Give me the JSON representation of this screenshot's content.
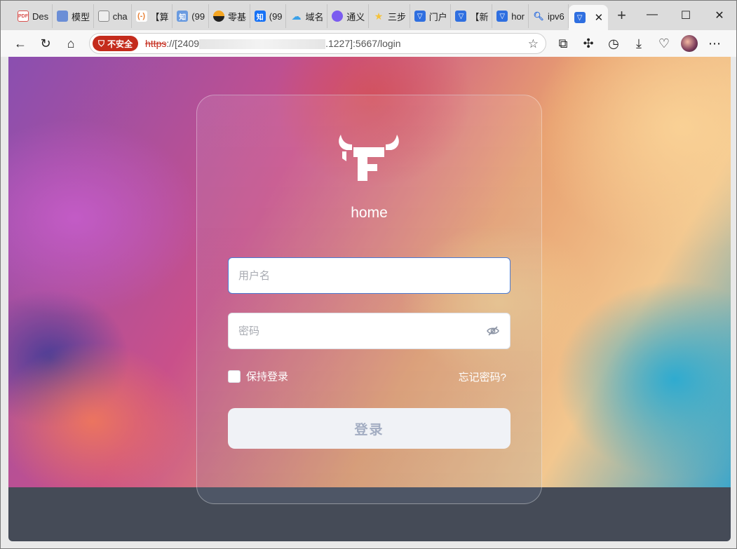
{
  "browser": {
    "tabs": [
      {
        "label": "Des",
        "icon": "pdf-icon",
        "color": "#d9534f"
      },
      {
        "label": "模型",
        "icon": "book-icon",
        "color": "#6b8ed6"
      },
      {
        "label": "cha",
        "icon": "page-icon",
        "color": "#888888"
      },
      {
        "label": "【算",
        "icon": "code-icon",
        "color": "#e8833a"
      },
      {
        "label": "(99",
        "icon": "zhihu-icon",
        "color": "#6a9be0"
      },
      {
        "label": "零基",
        "icon": "circle-icon",
        "color": "#333333"
      },
      {
        "label": "(99",
        "icon": "zhihu-icon",
        "color": "#1772f6"
      },
      {
        "label": "域名",
        "icon": "cloud-icon",
        "color": "#3aa0e8"
      },
      {
        "label": "通义",
        "icon": "tongyi-icon",
        "color": "#7b5cf0"
      },
      {
        "label": "三步",
        "icon": "star-icon",
        "color": "#f5c23a"
      },
      {
        "label": "门户",
        "icon": "bull-icon",
        "color": "#2f6fe0"
      },
      {
        "label": "【新",
        "icon": "bull-icon",
        "color": "#2f6fe0"
      },
      {
        "label": "hor",
        "icon": "bull-icon",
        "color": "#2f6fe0"
      },
      {
        "label": "ipv6",
        "icon": "search-icon",
        "color": "#2f6fe0"
      }
    ],
    "active_tab_icon": "bull-icon",
    "window_controls": {
      "minimize": "—",
      "maximize": "☐",
      "close": "✕"
    },
    "insecure_label": "不安全",
    "url_scheme": "https",
    "url_part1": "://[2409",
    "url_part2": ".1227]",
    "url_part3": ":5667/login"
  },
  "login": {
    "app_name": "home",
    "username_placeholder": "用户名",
    "password_placeholder": "密码",
    "remember_label": "保持登录",
    "forgot_label": "忘记密码?",
    "submit_label": "登录"
  }
}
